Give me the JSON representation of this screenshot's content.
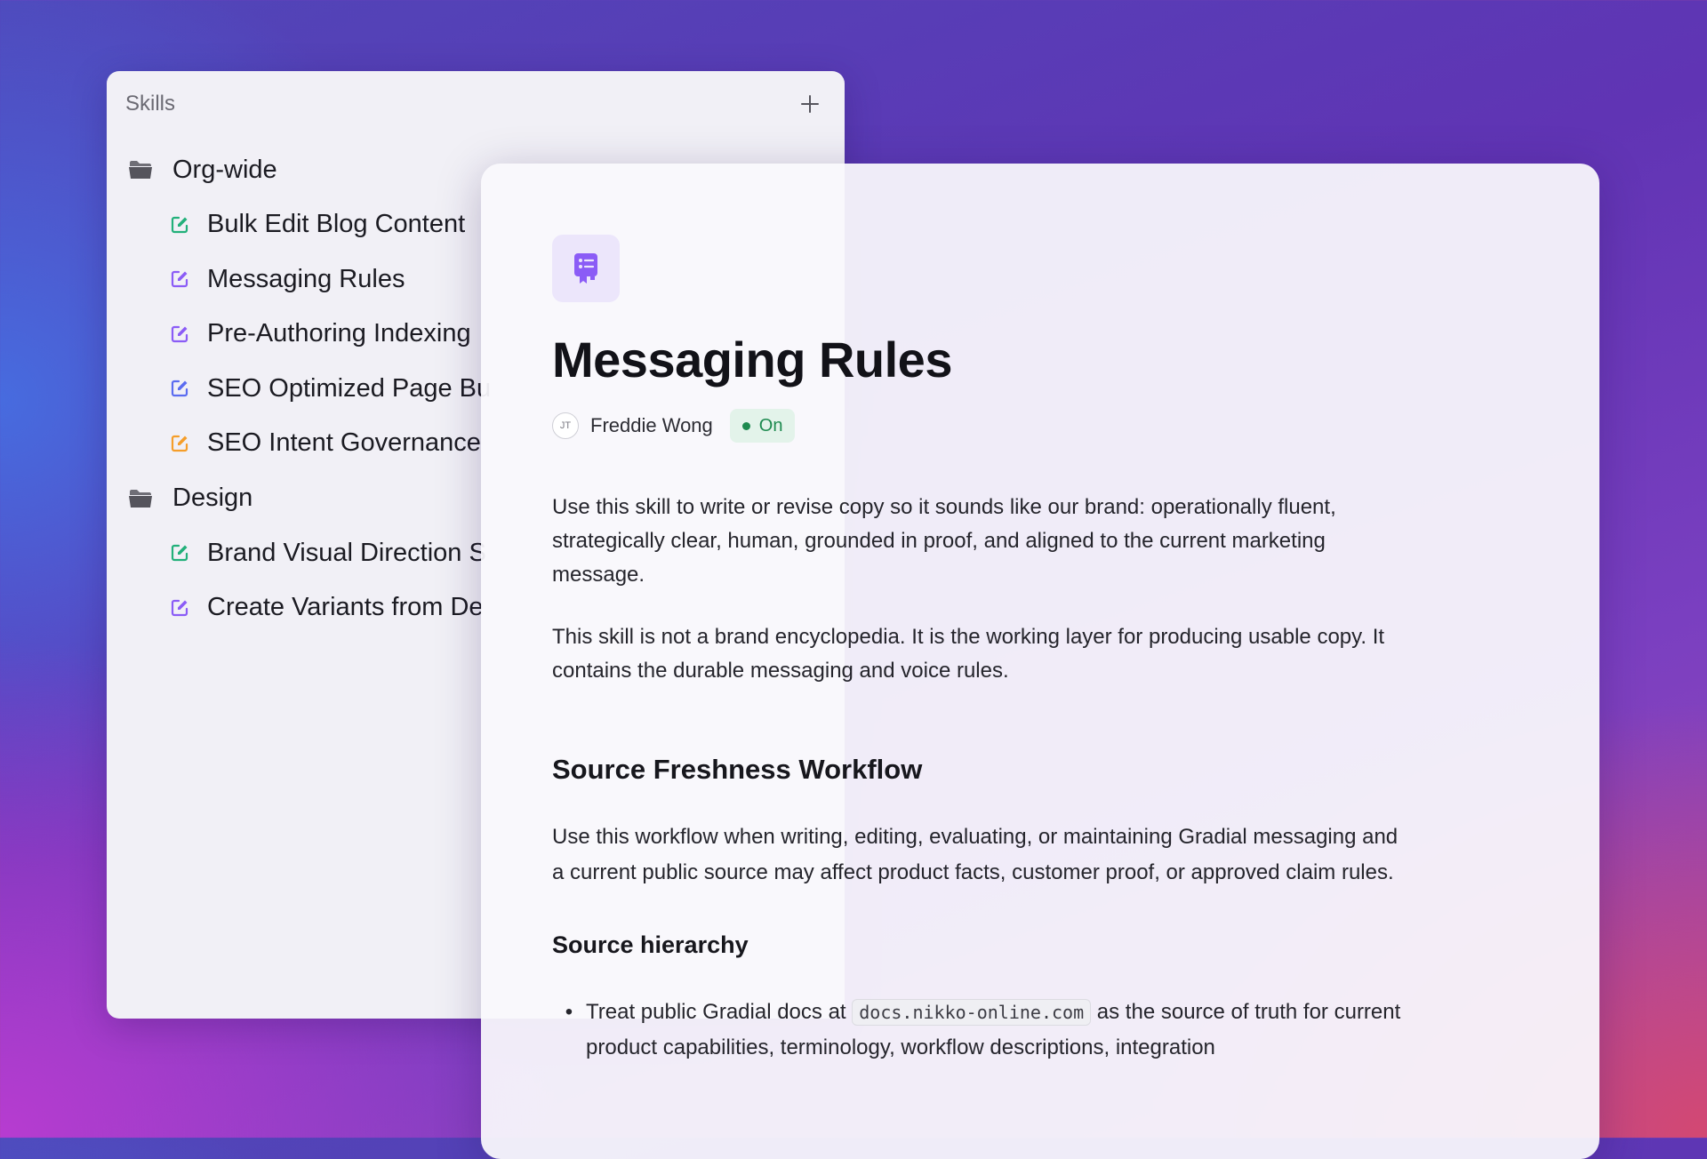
{
  "sidebar": {
    "title": "Skills",
    "add_icon": "plus-icon",
    "folders": [
      {
        "label": "Org-wide",
        "icon": "folder-icon",
        "items": [
          {
            "label": "Bulk Edit Blog Content",
            "icon_color": "#22b07a"
          },
          {
            "label": "Messaging Rules",
            "icon_color": "#8b5cf6"
          },
          {
            "label": "Pre-Authoring Indexing",
            "icon_color": "#8b5cf6"
          },
          {
            "label": "SEO Optimized Page Bu",
            "icon_color": "#5b6cf0"
          },
          {
            "label": "SEO Intent Governance",
            "icon_color": "#f59e2a"
          }
        ]
      },
      {
        "label": "Design",
        "icon": "folder-icon",
        "items": [
          {
            "label": "Brand Visual Direction S",
            "icon_color": "#22b07a"
          },
          {
            "label": "Create Variants from De",
            "icon_color": "#8b5cf6"
          }
        ]
      }
    ]
  },
  "detail": {
    "icon": "skill-book-icon",
    "accent": "#8b5cf6",
    "title": "Messaging Rules",
    "author_initials": "JT",
    "author": "Freddie Wong",
    "status": "On",
    "status_color": "#1d8a4f",
    "paragraph_1": "Use this skill to write or revise copy so it sounds like our brand: operationally fluent, strategically clear, human, grounded in proof, and aligned to the current marketing message.",
    "paragraph_2": "This skill is not a brand encyclopedia. It is the working layer for producing usable copy. It contains the durable messaging and voice rules.",
    "section_heading": "Source Freshness Workflow",
    "paragraph_3": "Use this workflow when writing, editing, evaluating, or maintaining Gradial messaging and a current public source may affect product facts, customer proof, or approved claim rules.",
    "subsection_heading": "Source hierarchy",
    "bullet_1": {
      "before": "Treat public Gradial docs at ",
      "code": "docs.nikko-online.com",
      "after": " as the source of truth for current product capabilities,  terminology, workflow descriptions, integration"
    }
  }
}
